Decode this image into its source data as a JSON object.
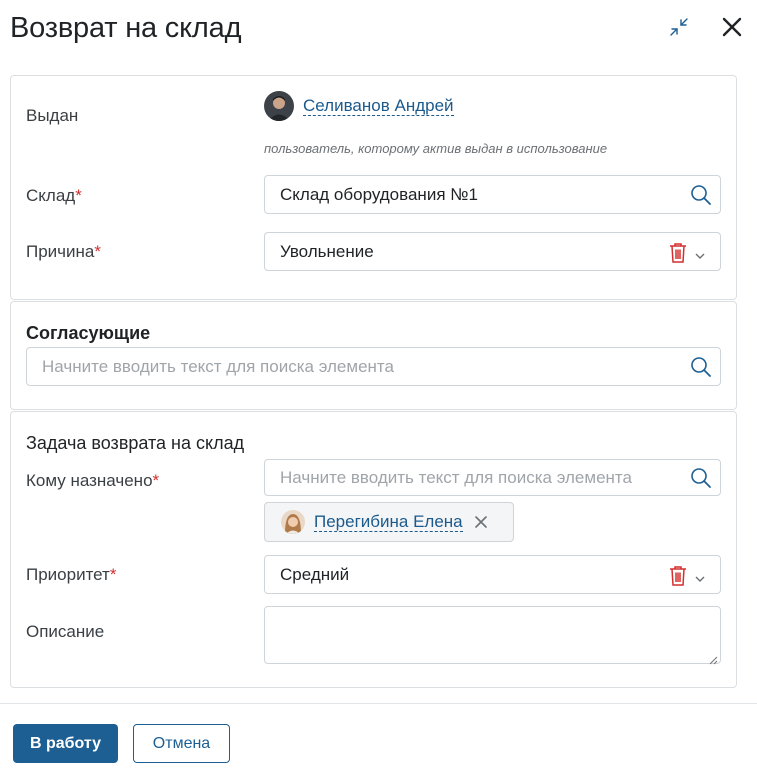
{
  "dialog": {
    "title": "Возврат на склад",
    "collapse_icon": "collapse-icon",
    "close_icon": "close-icon"
  },
  "issued": {
    "label": "Выдан",
    "user_name": "Селиванов Андрей",
    "hint": "пользователь, которому актив выдан в использование"
  },
  "warehouse": {
    "label": "Склад",
    "required_mark": "*",
    "value": "Склад оборудования №1",
    "icon": "search-icon"
  },
  "reason": {
    "label": "Причина",
    "required_mark": "*",
    "value": "Увольнение",
    "icons": [
      "trash-icon",
      "chevron-down-icon"
    ]
  },
  "approvers": {
    "title": "Согласующие",
    "placeholder": "Начните вводить текст для поиска элемента",
    "icon": "search-icon"
  },
  "task": {
    "title": "Задача возврата на склад",
    "assignee": {
      "label": "Кому назначено",
      "required_mark": "*",
      "placeholder": "Начните вводить текст для поиска элемента",
      "selected_name": "Перегибина Елена",
      "remove_icon": "close-icon"
    },
    "priority": {
      "label": "Приоритет",
      "required_mark": "*",
      "value": "Средний"
    },
    "description": {
      "label": "Описание",
      "value": ""
    }
  },
  "footer": {
    "primary_label": "В работу",
    "secondary_label": "Отмена"
  },
  "colors": {
    "accent": "#1d5f93",
    "link": "#1c5a8c",
    "required": "#d32f2f",
    "trash": "#d32f2f"
  }
}
